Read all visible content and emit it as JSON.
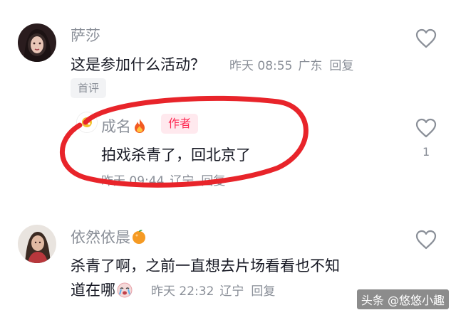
{
  "comments": [
    {
      "username": "萨莎",
      "text": "这是参加什么活动？",
      "time": "昨天 08:55",
      "location": "广东",
      "reply_label": "回复",
      "badge": "首评"
    },
    {
      "username": "成名",
      "username_emoji": "fire-icon",
      "author_badge": "作者",
      "text": "拍戏杀青了，回北京了",
      "time": "昨天 09:44",
      "location": "辽宁",
      "reply_label": "回复",
      "like_count": "1"
    },
    {
      "username": "依然依晨",
      "username_emoji": "orange-icon",
      "text_line1": "杀青了啊，之前一直想去片场看看也不知",
      "text_line2": "道在哪",
      "text_emoji": "crying-face-icon",
      "time": "昨天 22:32",
      "location": "辽宁",
      "reply_label": "回复"
    }
  ],
  "watermark": "头条 @悠悠小趣",
  "colors": {
    "username": "#8a8f98",
    "text": "#161823",
    "author_badge": "#fe2c55",
    "annotation_circle": "#e8242a"
  }
}
